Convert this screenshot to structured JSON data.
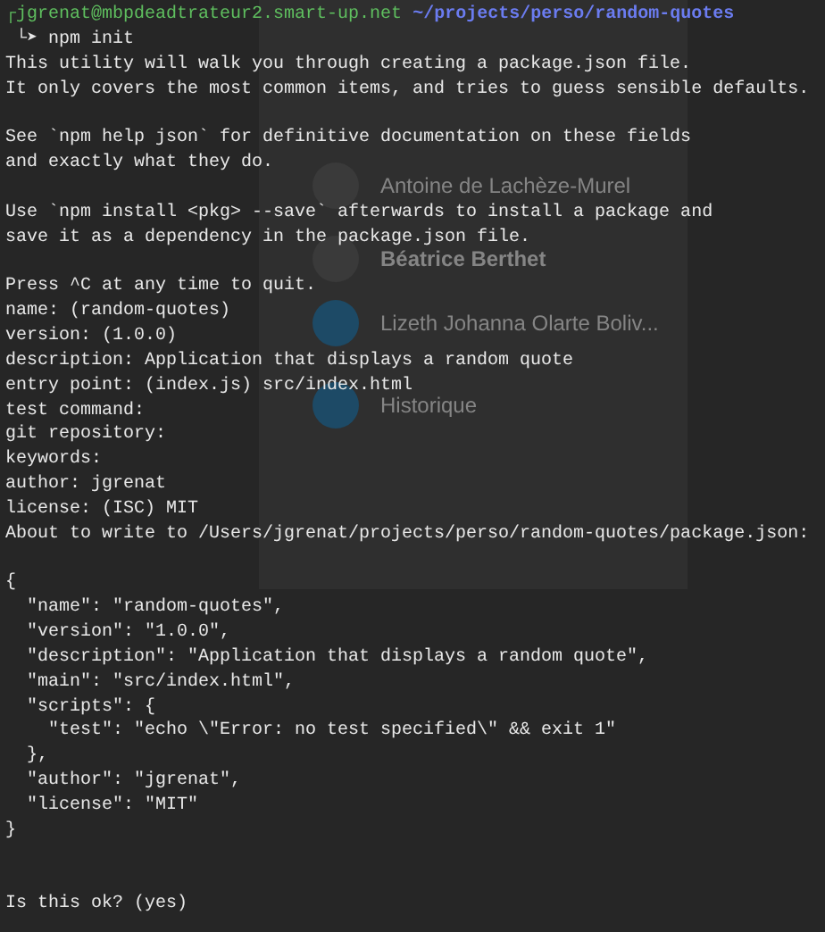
{
  "background_app": {
    "items": [
      {
        "name": "Antoine de Lachèze-Murel",
        "kind": "person"
      },
      {
        "name": "Béatrice Berthet",
        "kind": "person"
      },
      {
        "name": "Lizeth Johanna Olarte Boliv...",
        "kind": "group"
      },
      {
        "name": "Historique",
        "kind": "history"
      }
    ]
  },
  "prompt": {
    "corner": "┌",
    "user_host": "jgrenat@mbpdeadtrateur2.smart-up.net",
    "path": "~/projects/perso/random-quotes"
  },
  "command": {
    "arrow": "└➤",
    "text": "npm init"
  },
  "output_blocks": [
    [
      "This utility will walk you through creating a package.json file.",
      "It only covers the most common items, and tries to guess sensible defaults."
    ],
    [
      "See `npm help json` for definitive documentation on these fields",
      "and exactly what they do."
    ],
    [
      "Use `npm install <pkg> --save` afterwards to install a package and",
      "save it as a dependency in the package.json file."
    ],
    [
      "Press ^C at any time to quit.",
      "name: (random-quotes)",
      "version: (1.0.0)",
      "description: Application that displays a random quote",
      "entry point: (index.js) src/index.html",
      "test command:",
      "git repository:",
      "keywords:",
      "author: jgrenat",
      "license: (ISC) MIT",
      "About to write to /Users/jgrenat/projects/perso/random-quotes/package.json:"
    ],
    [
      "{",
      "  \"name\": \"random-quotes\",",
      "  \"version\": \"1.0.0\",",
      "  \"description\": \"Application that displays a random quote\",",
      "  \"main\": \"src/index.html\",",
      "  \"scripts\": {",
      "    \"test\": \"echo \\\"Error: no test specified\\\" && exit 1\"",
      "  },",
      "  \"author\": \"jgrenat\",",
      "  \"license\": \"MIT\"",
      "}"
    ]
  ],
  "question": "Is this ok? (yes)"
}
